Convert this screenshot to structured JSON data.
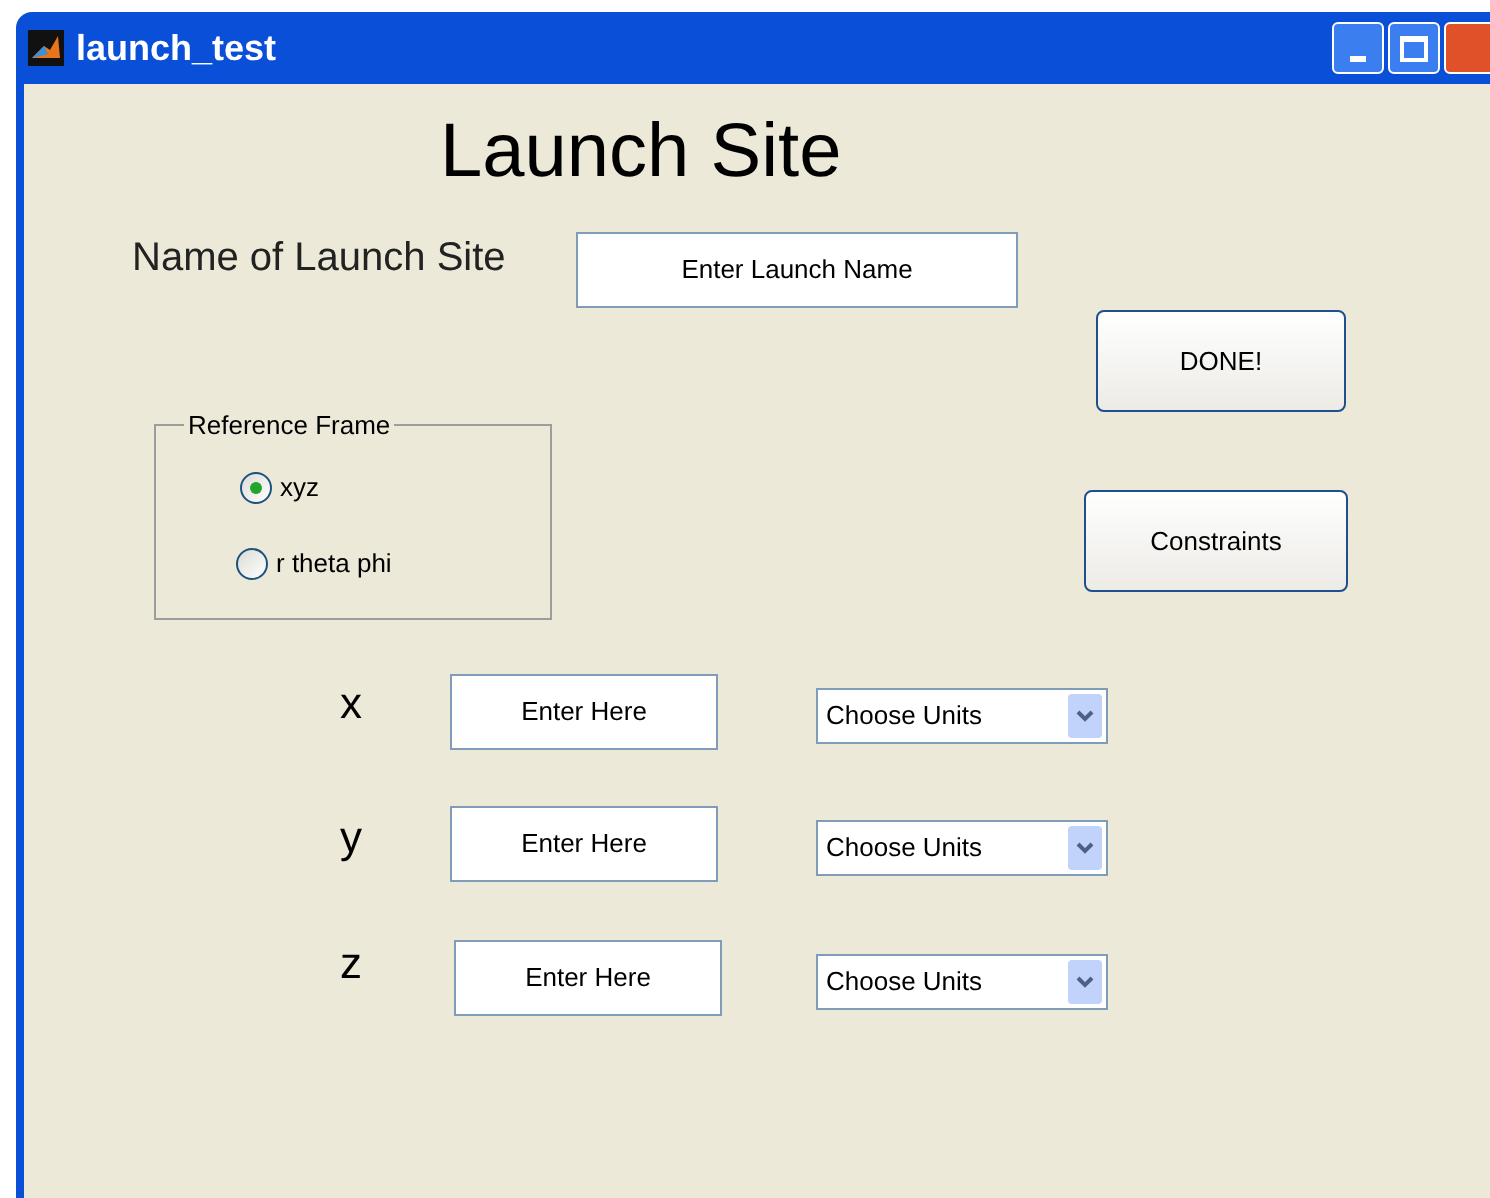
{
  "window": {
    "title": "launch_test"
  },
  "heading": "Launch Site",
  "launch_name": {
    "label": "Name of Launch Site",
    "value": "Enter Launch Name"
  },
  "buttons": [
    {
      "label": "DONE!"
    },
    {
      "label": "Constraints"
    }
  ],
  "reference_frame": {
    "title": "Reference Frame",
    "options": [
      {
        "label": "xyz",
        "selected": true
      },
      {
        "label": "r theta phi",
        "selected": false
      }
    ]
  },
  "coordinates": [
    {
      "label": "x",
      "value": "Enter Here",
      "units": "Choose Units"
    },
    {
      "label": "y",
      "value": "Enter Here",
      "units": "Choose Units"
    },
    {
      "label": "z",
      "value": "Enter Here",
      "units": "Choose Units"
    }
  ]
}
